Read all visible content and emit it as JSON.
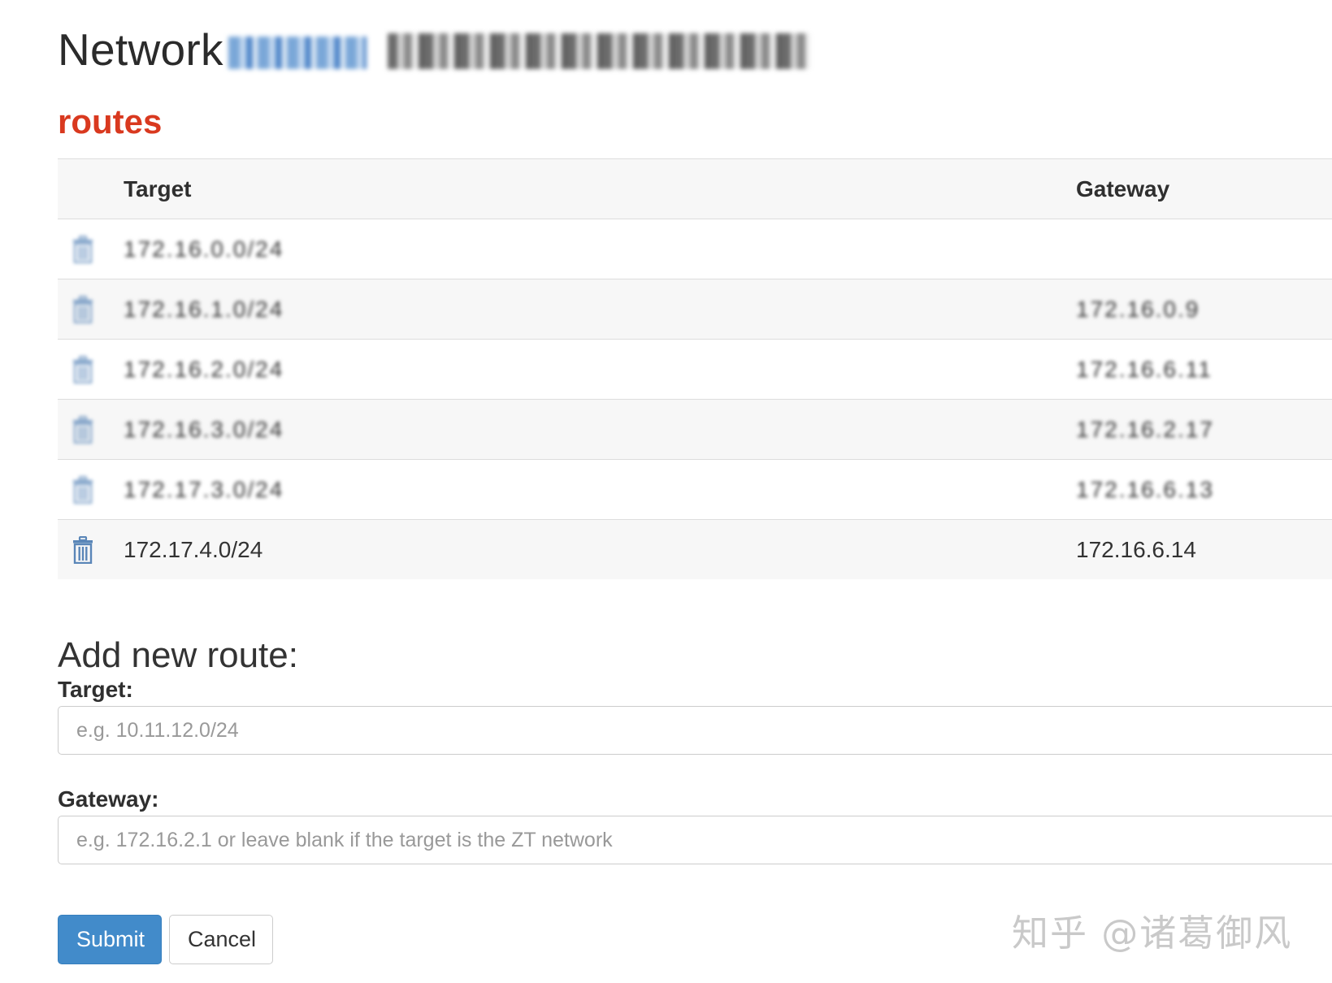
{
  "header": {
    "title_prefix": "Network",
    "network_id_redacted": true
  },
  "routes_section": {
    "title": "routes",
    "columns": {
      "target": "Target",
      "gateway": "Gateway"
    },
    "rows": [
      {
        "target": "172.16.0.0/24",
        "gateway": "",
        "redacted": true
      },
      {
        "target": "172.16.1.0/24",
        "gateway": "172.16.0.9",
        "redacted": true
      },
      {
        "target": "172.16.2.0/24",
        "gateway": "172.16.6.11",
        "redacted": true
      },
      {
        "target": "172.16.3.0/24",
        "gateway": "172.16.2.17",
        "redacted": true
      },
      {
        "target": "172.17.3.0/24",
        "gateway": "172.16.6.13",
        "redacted": true
      },
      {
        "target": "172.17.4.0/24",
        "gateway": "172.16.6.14",
        "redacted": false
      }
    ]
  },
  "add_route": {
    "title": "Add new route:",
    "target_label": "Target:",
    "target_placeholder": "e.g. 10.11.12.0/24",
    "gateway_label": "Gateway:",
    "gateway_placeholder": "e.g. 172.16.2.1 or leave blank if the target is the ZT network",
    "submit_label": "Submit",
    "cancel_label": "Cancel"
  },
  "watermark": "知乎 @诸葛御风",
  "colors": {
    "accent_red": "#d9391f",
    "primary_blue": "#428bca",
    "icon_blue": "#5a86b8",
    "stripe": "#f7f7f7"
  },
  "icons": {
    "delete": "trash-icon"
  }
}
